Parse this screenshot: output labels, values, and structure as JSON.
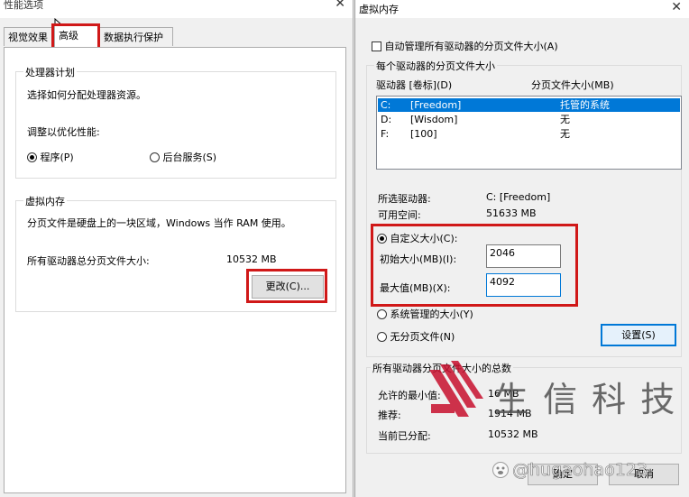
{
  "perf_window": {
    "title": "性能选项",
    "close": "✕",
    "tabs": [
      "视觉效果",
      "高级",
      "数据执行保护"
    ],
    "processor_group": {
      "label": "处理器计划",
      "desc": "选择如何分配处理器资源。",
      "optimize_label": "调整以优化性能:",
      "opt_programs": "程序(P)",
      "opt_background": "后台服务(S)"
    },
    "vm_group": {
      "label": "虚拟内存",
      "desc": "分页文件是硬盘上的一块区域，Windows 当作 RAM 使用。",
      "total_label": "所有驱动器总分页文件大小:",
      "total_value": "10532 MB",
      "change_button": "更改(C)..."
    }
  },
  "vm_window": {
    "title": "虚拟内存",
    "close": "✕",
    "auto_manage": "自动管理所有驱动器的分页文件大小(A)",
    "per_drive_group": "每个驱动器的分页文件大小",
    "col_drive": "驱动器 [卷标](D)",
    "col_size": "分页文件大小(MB)",
    "drives": [
      {
        "drive": "C:",
        "label": "[Freedom]",
        "size": "托管的系统",
        "selected": true
      },
      {
        "drive": "D:",
        "label": "[Wisdom]",
        "size": "无",
        "selected": false
      },
      {
        "drive": "F:",
        "label": "[100]",
        "size": "无",
        "selected": false
      }
    ],
    "selected_drive_label": "所选驱动器:",
    "selected_drive_value": "C:  [Freedom]",
    "free_space_label": "可用空间:",
    "free_space_value": "51633 MB",
    "custom_size": "自定义大小(C):",
    "initial_label": "初始大小(MB)(I):",
    "initial_value": "2046",
    "max_label": "最大值(MB)(X):",
    "max_value": "4092",
    "system_managed": "系统管理的大小(Y)",
    "no_paging": "无分页文件(N)",
    "set_button": "设置(S)",
    "totals_group": "所有驱动器分页文件大小的总数",
    "min_allowed_label": "允许的最小值:",
    "min_allowed_value": "16 MB",
    "recommended_label": "推荐:",
    "recommended_value": "1914 MB",
    "current_label": "当前已分配:",
    "current_value": "10532 MB",
    "ok_button": "确定",
    "cancel_button": "取消"
  },
  "watermark": {
    "logo_text": "生 信 科 技",
    "handle": "@hugaohao123"
  },
  "colors": {
    "highlight_box": "#d01818",
    "selection": "#0078d7",
    "watermark_red": "#c8102e"
  }
}
